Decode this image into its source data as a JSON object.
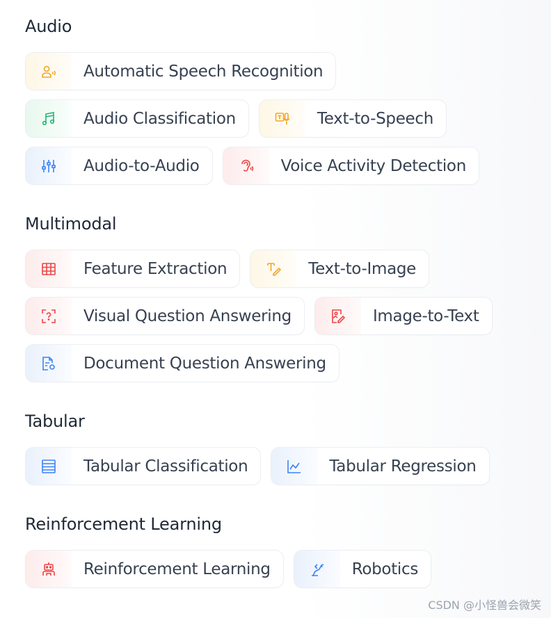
{
  "sections": [
    {
      "title": "Audio",
      "rows": [
        [
          {
            "label": "Automatic Speech Recognition",
            "icon": "speech-recognition-icon",
            "color": "#f5a623"
          }
        ],
        [
          {
            "label": "Audio Classification",
            "icon": "music-note-icon",
            "color": "#22b573"
          },
          {
            "label": "Text-to-Speech",
            "icon": "text-to-speech-icon",
            "color": "#f5a623"
          }
        ],
        [
          {
            "label": "Audio-to-Audio",
            "icon": "equalizer-sliders-icon",
            "color": "#3b82f6"
          },
          {
            "label": "Voice Activity Detection",
            "icon": "ear-icon",
            "color": "#ef4444"
          }
        ]
      ]
    },
    {
      "title": "Multimodal",
      "rows": [
        [
          {
            "label": "Feature Extraction",
            "icon": "table-grid-icon",
            "color": "#ef4444"
          },
          {
            "label": "Text-to-Image",
            "icon": "text-pencil-icon",
            "color": "#f5a623"
          }
        ],
        [
          {
            "label": "Visual Question Answering",
            "icon": "question-frame-icon",
            "color": "#ef4444"
          },
          {
            "label": "Image-to-Text",
            "icon": "image-edit-icon",
            "color": "#ef4444"
          }
        ],
        [
          {
            "label": "Document Question Answering",
            "icon": "document-search-icon",
            "color": "#3b82f6"
          }
        ]
      ]
    },
    {
      "title": "Tabular",
      "rows": [
        [
          {
            "label": "Tabular Classification",
            "icon": "table-rows-icon",
            "color": "#3b82f6"
          },
          {
            "label": "Tabular Regression",
            "icon": "line-chart-icon",
            "color": "#3b82f6"
          }
        ]
      ]
    },
    {
      "title": "Reinforcement Learning",
      "rows": [
        [
          {
            "label": "Reinforcement Learning",
            "icon": "robot-icon",
            "color": "#ef4444"
          },
          {
            "label": "Robotics",
            "icon": "robot-arm-icon",
            "color": "#3b82f6"
          }
        ]
      ]
    }
  ],
  "watermark": "CSDN @小怪兽会微笑"
}
